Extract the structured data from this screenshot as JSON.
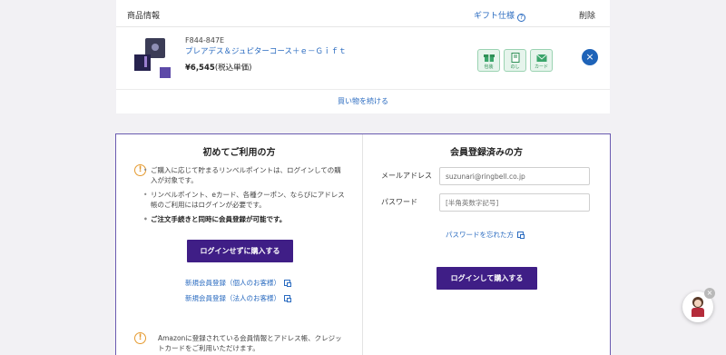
{
  "cart": {
    "header_info": "商品情報",
    "header_gift": "ギフト仕様",
    "header_gift_help": "?",
    "header_delete": "削除",
    "item": {
      "code": "F844-847E",
      "name": "プレアデス＆ジュピターコース＋ｅ－Ｇｉｆｔ",
      "price": "¥6,545",
      "price_note": "(税込単価)"
    },
    "gift_options": [
      {
        "label": "包装",
        "icon": "gift-box-icon"
      },
      {
        "label": "のし",
        "icon": "noshi-icon"
      },
      {
        "label": "カード",
        "icon": "card-envelope-icon"
      }
    ],
    "delete_symbol": "×",
    "continue_label": "買い物を続ける"
  },
  "guest": {
    "title": "初めてご利用の方",
    "warn_symbol": "!",
    "notes": [
      "ご購入に応じて貯まるリンベルポイントは、ログインしての購入が対象です。",
      "リンベルポイント、eカード、各種クーポン、ならびにアドレス帳のご利用にはログインが必要です。",
      "ご注文手続きと同時に会員登録が可能です。"
    ],
    "buy_button": "ログインせずに購入する",
    "register_personal": "新規会員登録（個人のお客様）",
    "register_corporate": "新規会員登録（法人のお客様）",
    "amazon_note": "Amazonに登録されている会員情報とアドレス帳、クレジットカードをご利用いただけます。"
  },
  "member": {
    "title": "会員登録済みの方",
    "email_label": "メールアドレス",
    "email_value": "suzunari@ringbell.co.jp",
    "password_label": "パスワード",
    "password_placeholder": "[半角英数字記号]",
    "forgot_label": "パスワードを忘れた方",
    "login_button": "ログインして購入する"
  },
  "chat": {
    "close_symbol": "×"
  },
  "colors": {
    "accent_purple": "#3f1e86",
    "link_blue": "#2a6bc0",
    "gift_green": "#2f8f56",
    "warn_orange": "#e59a2f"
  }
}
